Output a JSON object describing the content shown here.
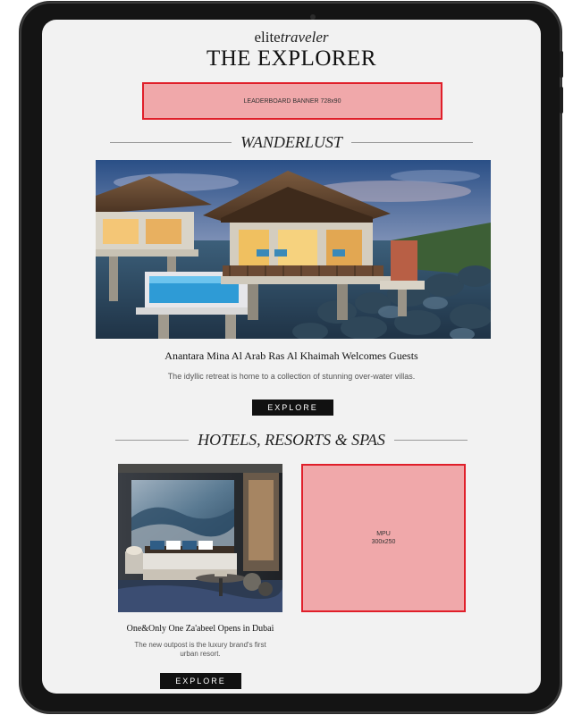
{
  "brand": {
    "left": "elite",
    "right": "traveler"
  },
  "page_title": "THE EXPLORER",
  "leaderboard_ad": {
    "label": "LEADERBOARD BANNER 728x90"
  },
  "sections": [
    {
      "label": "WANDERLUST"
    },
    {
      "label": "HOTELS, RESORTS & SPAS"
    }
  ],
  "feature": {
    "title": "Anantara Mina Al Arab Ras Al Khaimah Welcomes Guests",
    "description": "The idyllic retreat is home to a collection of stunning over-water villas.",
    "button": "EXPLORE"
  },
  "card": {
    "title": "One&Only One Za'abeel Opens in Dubai",
    "description_line1": "The new outpost is the luxury brand's first",
    "description_line2": "urban resort.",
    "button": "EXPLORE"
  },
  "mpu_ad": {
    "label_line1": "MPU",
    "label_line2": "300x250"
  },
  "colors": {
    "ad_fill": "#f0a8aa",
    "ad_border": "#e01f2a",
    "button_bg": "#111111",
    "screen_bg": "#f2f2f2"
  }
}
